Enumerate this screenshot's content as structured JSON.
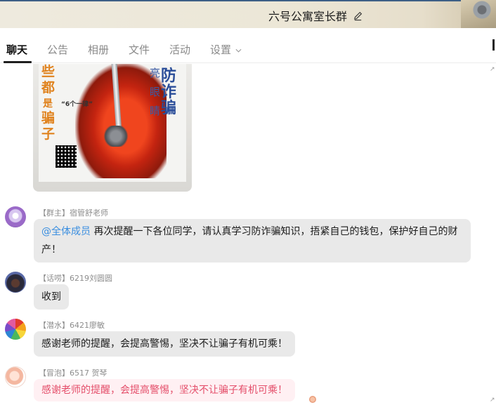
{
  "window": {
    "title": "六号公寓室长群"
  },
  "tabs": [
    {
      "label": "聊天",
      "active": true
    },
    {
      "label": "公告"
    },
    {
      "label": "相册"
    },
    {
      "label": "文件"
    },
    {
      "label": "活动"
    },
    {
      "label": "设置"
    }
  ],
  "photo": {
    "left_chars": [
      "些",
      "都",
      "是",
      "骗",
      "子"
    ],
    "title_chars": "防诈骗",
    "side_chars": [
      "亮",
      "眼",
      "睛"
    ],
    "rule_text": "“6个一律”"
  },
  "messages": [
    {
      "sender": "【群主】宿管舒老师",
      "mention": "@全体成员",
      "text": " 再次提醒一下各位同学，请认真学习防诈骗知识，捂紧自己的钱包，保护好自己的财产！"
    },
    {
      "sender": "【话唠】6219刘圆圆",
      "text": "收到"
    },
    {
      "sender": "【潜水】6421廖敏",
      "text": "感谢老师的提醒，会提高警惕，坚决不让骗子有机可乘！"
    },
    {
      "sender": "【冒泡】6517  贺琴",
      "text": "感谢老师的提醒，会提高警惕，坚决不让骗子有机可乘！"
    }
  ],
  "colors": {
    "mention": "#3a8ee0",
    "pink_text": "#e44e6a",
    "bubble_bg": "#e9e9e9"
  }
}
